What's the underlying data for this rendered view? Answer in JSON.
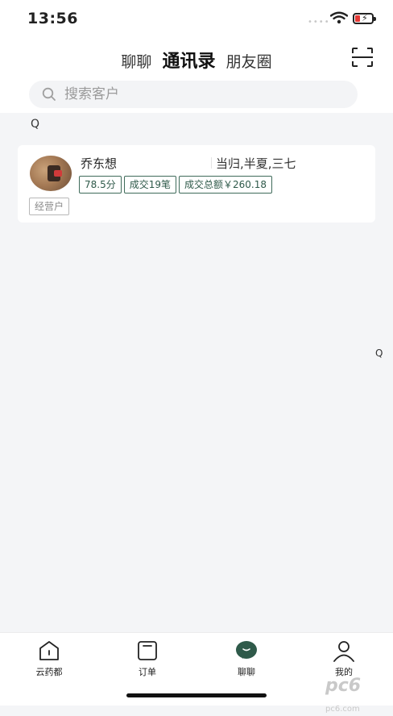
{
  "status_bar": {
    "time": "13:56",
    "signal": "••••",
    "colors": {
      "battery_low": "#e53935"
    }
  },
  "header": {
    "tabs": [
      {
        "label": "聊聊",
        "active": false
      },
      {
        "label": "通讯录",
        "active": true
      },
      {
        "label": "朋友圈",
        "active": false
      }
    ],
    "scan_icon": "scan-icon"
  },
  "search": {
    "placeholder": "搜索客户",
    "icon": "search-icon"
  },
  "contacts": {
    "section_label": "Q",
    "index_letter": "Q",
    "items": [
      {
        "name": "乔东想",
        "products": "当归,半夏,三七",
        "tags": [
          "78.5分",
          "成交19笔",
          "成交总额￥260.18"
        ],
        "type_tag": "经营户"
      }
    ]
  },
  "bottom_nav": {
    "accent_color": "#2f5a4a",
    "items": [
      {
        "label": "云药都",
        "icon": "home-icon"
      },
      {
        "label": "订单",
        "icon": "order-icon"
      },
      {
        "label": "聊聊",
        "icon": "chat-icon",
        "active": true
      },
      {
        "label": "我的",
        "icon": "profile-icon"
      }
    ]
  },
  "watermark": {
    "text": "pc6",
    "suffix": "pc6.com"
  }
}
